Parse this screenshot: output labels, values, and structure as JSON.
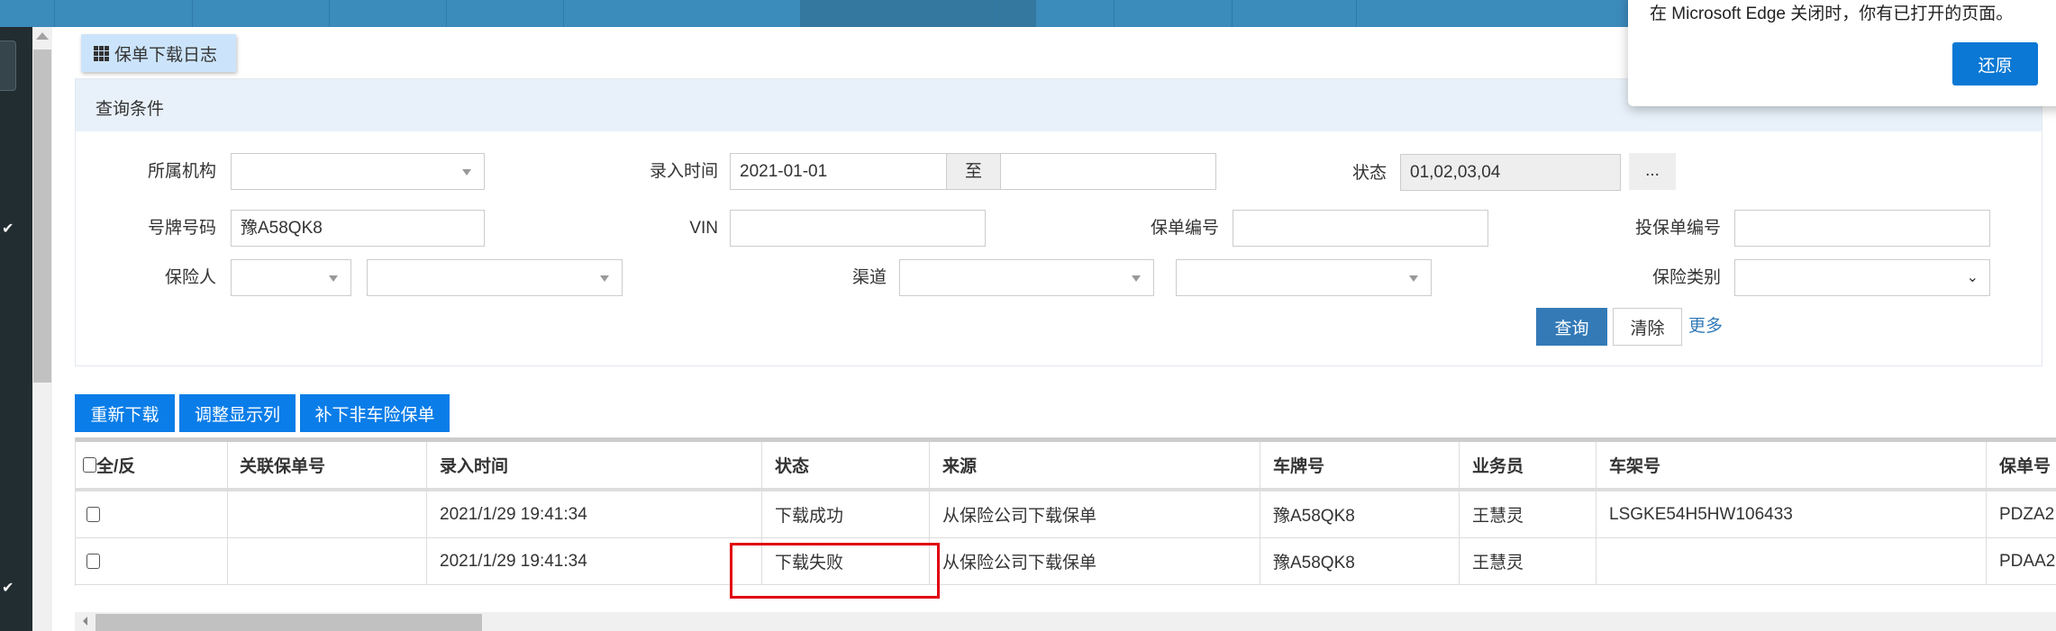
{
  "title_tab": {
    "label": "保单下载日志",
    "icon": "grid-icon"
  },
  "panel": {
    "title": "查询条件"
  },
  "form": {
    "org_label": "所属机构",
    "org_value": "",
    "entry_time_label": "录入时间",
    "entry_time_from": "2021-01-01",
    "entry_time_sep": "至",
    "entry_time_to": "",
    "status_label": "状态",
    "status_value": "01,02,03,04",
    "status_more": "...",
    "plate_label": "号牌号码",
    "plate_value": "豫A58QK8",
    "vin_label": "VIN",
    "vin_value": "",
    "policy_no_label": "保单编号",
    "policy_no_value": "",
    "proposal_no_label": "投保单编号",
    "proposal_no_value": "",
    "insurer_label": "保险人",
    "channel_label": "渠道",
    "insurance_type_label": "保险类别",
    "query_button": "查询",
    "clear_button": "清除",
    "more_link": "更多"
  },
  "actions": [
    "重新下载",
    "调整显示列",
    "补下非车险保单"
  ],
  "table": {
    "columns": [
      "全/反",
      "关联保单号",
      "录入时间",
      "状态",
      "来源",
      "车牌号",
      "业务员",
      "车架号",
      "保单号"
    ],
    "rows": [
      [
        "",
        "",
        "2021/1/29 19:41:34",
        "下载成功",
        "从保险公司下载保单",
        "豫A58QK8",
        "王慧灵",
        "LSGKE54H5HW106433",
        "PDZA2"
      ],
      [
        "",
        "",
        "2021/1/29 19:41:34",
        "下载失败",
        "从保险公司下载保单",
        "豫A58QK8",
        "王慧灵",
        "",
        "PDAA2"
      ]
    ]
  },
  "edge_popup": {
    "message": "在 Microsoft Edge 关闭时，你有已打开的页面。",
    "restore_button": "还原"
  },
  "colors": {
    "topbar": "#3b8bbb",
    "action_blue": "#0a7de8",
    "query_blue": "#337ab7",
    "highlight_red": "#e0000f"
  }
}
